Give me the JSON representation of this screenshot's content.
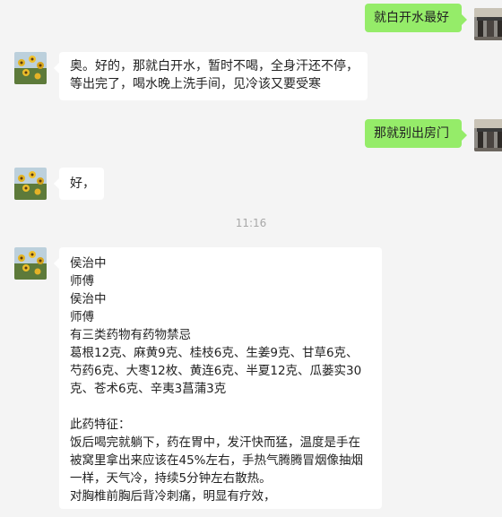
{
  "conversation": {
    "messages": [
      {
        "sender": "me",
        "text": "就白开水最好"
      },
      {
        "sender": "contact",
        "lines": [
          "奥。好的，那就白开水，暂时不喝，全身汗还不停，",
          "等出完了，喝水晚上洗手间，见冷该又要受寒"
        ]
      },
      {
        "sender": "me",
        "text": "那就别出房门"
      },
      {
        "sender": "contact",
        "text": "好，"
      },
      {
        "sender": "contact",
        "lines": [
          "侯治中",
          "师傅",
          "侯治中",
          "师傅",
          "有三类药物有药物禁忌",
          "葛根12克、麻黄9克、桂枝6克、生姜9克、甘草6克、",
          "芍药6克、大枣12枚、黄连6克、半夏12克、瓜蒌实30",
          "克、苍术6克、辛夷3菖蒲3克",
          "",
          "此药特征：",
          "饭后喝完就躺下，药在胃中，发汗快而猛，温度是手在",
          "被窝里拿出来应该在45%左右，手热气腾腾冒烟像抽烟",
          "一样，天气冷，持续5分钟左右散热。",
          "对胸椎前胸后背冷刺痛，明显有疗效，"
        ]
      }
    ],
    "timestamp": "11:16"
  },
  "colors": {
    "my_bubble": "#95ec69",
    "their_bubble": "#ffffff",
    "background": "#f4f4f4"
  }
}
